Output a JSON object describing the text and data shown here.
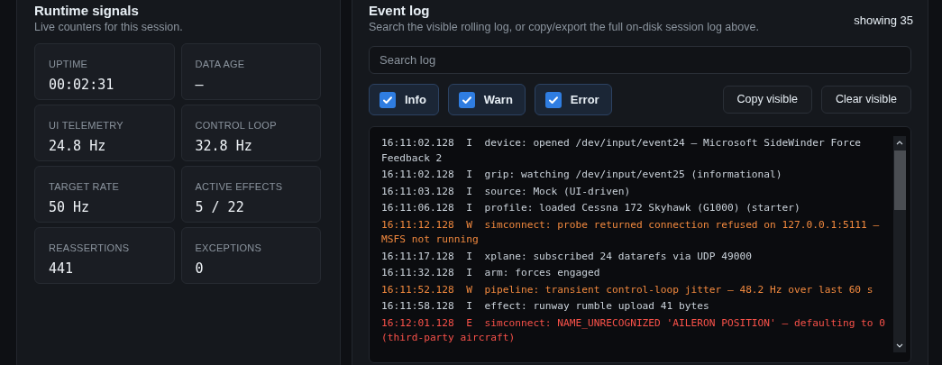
{
  "runtime": {
    "title": "Runtime signals",
    "subtitle": "Live counters for this session.",
    "stats": [
      {
        "label": "UPTIME",
        "value": "00:02:31"
      },
      {
        "label": "DATA AGE",
        "value": "—"
      },
      {
        "label": "UI TELEMETRY",
        "value": "24.8 Hz"
      },
      {
        "label": "CONTROL LOOP",
        "value": "32.8 Hz"
      },
      {
        "label": "TARGET RATE",
        "value": "50 Hz"
      },
      {
        "label": "ACTIVE EFFECTS",
        "value": "5 / 22"
      },
      {
        "label": "REASSERTIONS",
        "value": "441"
      },
      {
        "label": "EXCEPTIONS",
        "value": "0"
      }
    ]
  },
  "event_log": {
    "title": "Event log",
    "subtitle": "Search the visible rolling log, or copy/export the full on-disk session log above.",
    "count": "showing 35",
    "search": {
      "placeholder": "Search log"
    },
    "filters": [
      {
        "label": "Info",
        "checked": true
      },
      {
        "label": "Warn",
        "checked": true
      },
      {
        "label": "Error",
        "checked": true
      }
    ],
    "buttons": [
      "Copy visible",
      "Clear visible"
    ],
    "entries": [
      {
        "time": "16:11:02.128",
        "level": "I",
        "kind": "info",
        "message": "device: opened /dev/input/event24 — Microsoft SideWinder Force Feedback 2"
      },
      {
        "time": "16:11:02.128",
        "level": "I",
        "kind": "info",
        "message": "grip: watching /dev/input/event25 (informational)"
      },
      {
        "time": "16:11:03.128",
        "level": "I",
        "kind": "info",
        "message": "source: Mock (UI-driven)"
      },
      {
        "time": "16:11:06.128",
        "level": "I",
        "kind": "info",
        "message": "profile: loaded Cessna 172 Skyhawk (G1000) (starter)"
      },
      {
        "time": "16:11:12.128",
        "level": "W",
        "kind": "warn",
        "message": "simconnect: probe returned connection refused on 127.0.0.1:5111 — MSFS not running"
      },
      {
        "time": "16:11:17.128",
        "level": "I",
        "kind": "info",
        "message": "xplane: subscribed 24 datarefs via UDP 49000"
      },
      {
        "time": "16:11:32.128",
        "level": "I",
        "kind": "info",
        "message": "arm: forces engaged"
      },
      {
        "time": "16:11:52.128",
        "level": "W",
        "kind": "warn",
        "message": "pipeline: transient control-loop jitter — 48.2 Hz over last 60 s"
      },
      {
        "time": "16:11:58.128",
        "level": "I",
        "kind": "info",
        "message": "effect: runway rumble upload 41 bytes"
      },
      {
        "time": "16:12:01.128",
        "level": "E",
        "kind": "error",
        "message": "simconnect: NAME_UNRECOGNIZED 'AILERON POSITION' — defaulting to 0 (third-party aircraft)"
      }
    ]
  }
}
